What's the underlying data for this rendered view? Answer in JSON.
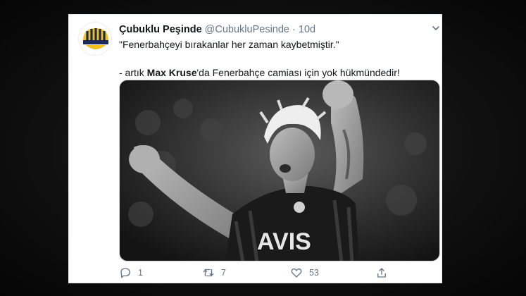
{
  "tweet": {
    "display_name": "Çubuklu Peşinde",
    "handle": "@CubukluPesinde",
    "separator": "·",
    "time": "10d",
    "line1": "\"Fenerbahçeyi bırakanlar her zaman kaybetmiştir.\"",
    "line2_prefix": "- artık ",
    "line2_bold": "Max Kruse",
    "line2_suffix": "'da Fenerbahçe camiası için yok hükmündedir!",
    "jersey_text": "AVIS"
  },
  "actions": {
    "reply_count": "1",
    "retweet_count": "7",
    "like_count": "53"
  },
  "icons": {
    "reply": "reply-icon",
    "retweet": "retweet-icon",
    "like": "heart-icon",
    "share": "share-icon",
    "caret": "chevron-down-icon"
  },
  "colors": {
    "name": "#14171a",
    "secondary": "#657786",
    "avatar_yellow": "#f2c11b",
    "avatar_navy": "#1b2a5a"
  }
}
